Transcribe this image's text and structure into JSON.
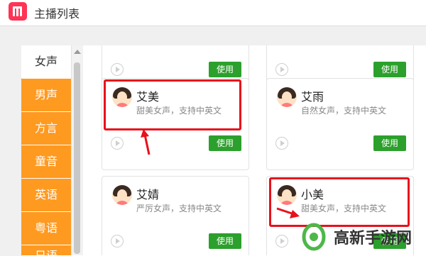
{
  "app": {
    "title": "主播列表",
    "icon": "app-logo-icon",
    "accent": "#ff3355"
  },
  "sidebar": {
    "accent": "#ff9a20",
    "items": [
      {
        "label": "女声",
        "active": true
      },
      {
        "label": "男声",
        "active": false
      },
      {
        "label": "方言",
        "active": false
      },
      {
        "label": "童音",
        "active": false
      },
      {
        "label": "英语",
        "active": false
      },
      {
        "label": "粤语",
        "active": false
      },
      {
        "label": "日语",
        "active": false
      }
    ]
  },
  "top_partial_cards": [
    {
      "use_label": "使用"
    },
    {
      "use_label": "使用"
    }
  ],
  "voices": [
    {
      "name": "艾美",
      "desc": "甜美女声，支持中英文",
      "use_label": "使用",
      "highlighted": true
    },
    {
      "name": "艾雨",
      "desc": "自然女声，支持中英文",
      "use_label": "使用",
      "highlighted": false
    },
    {
      "name": "艾婧",
      "desc": "严厉女声，支持中英文",
      "use_label": "使用",
      "highlighted": false
    },
    {
      "name": "小美",
      "desc": "甜美女声，支持中英文",
      "use_label": "使用",
      "highlighted": true
    }
  ],
  "watermark": {
    "text": "高新手游网",
    "logo_color": "#4db848"
  },
  "colors": {
    "use_button": "#2ca02c",
    "annotation": "#e8101b"
  }
}
